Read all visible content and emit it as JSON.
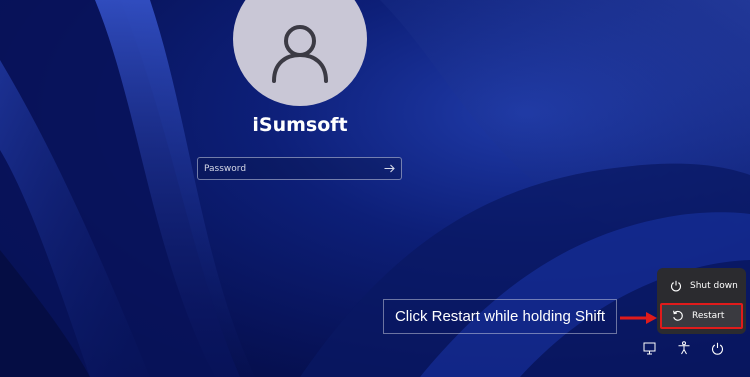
{
  "user": {
    "name": "iSumsoft"
  },
  "password": {
    "placeholder": "Password",
    "value": ""
  },
  "power_menu": {
    "items": [
      {
        "label": "Shut down",
        "icon": "power-icon"
      },
      {
        "label": "Restart",
        "icon": "restart-icon"
      }
    ],
    "highlighted": "Restart"
  },
  "annotation": {
    "text": "Click Restart while holding Shift"
  },
  "tray": {
    "icons": [
      "network-icon",
      "accessibility-icon",
      "power-icon"
    ]
  },
  "colors": {
    "background": "#0d1f78",
    "avatar": "#c9c7d6",
    "menu_bg": "#2b2b2f",
    "highlight": "#e01b1b"
  }
}
